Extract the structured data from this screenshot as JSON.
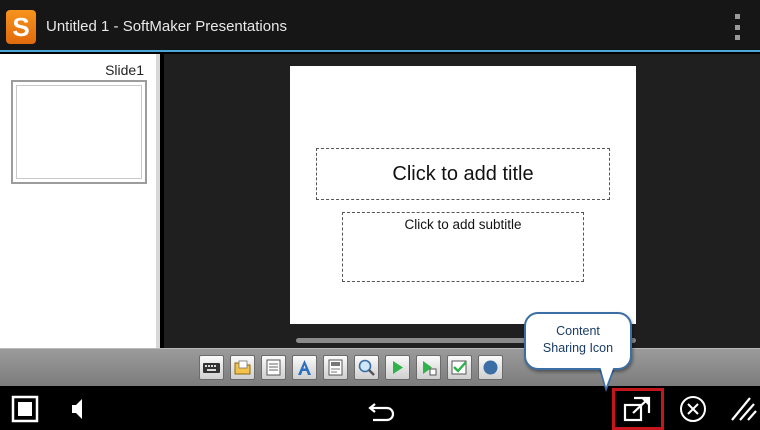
{
  "titlebar": {
    "logo_letter": "S",
    "title": "Untitled 1 - SoftMaker Presentations"
  },
  "slides_panel": {
    "slides": [
      {
        "label": "Slide1"
      }
    ]
  },
  "slide": {
    "title_placeholder": "Click to add title",
    "subtitle_placeholder": "Click to add subtitle"
  },
  "toolbar": {
    "buttons": [
      {
        "icon": "keyboard-icon"
      },
      {
        "icon": "open-folder-icon"
      },
      {
        "icon": "slide-layout-icon"
      },
      {
        "icon": "text-format-icon"
      },
      {
        "icon": "object-properties-icon"
      },
      {
        "icon": "zoom-icon"
      },
      {
        "icon": "play-icon"
      },
      {
        "icon": "play-from-current-icon"
      },
      {
        "icon": "checkbox-icon"
      },
      {
        "icon": "more-icon"
      }
    ]
  },
  "navbar": {
    "buttons": [
      {
        "icon": "recents-icon"
      },
      {
        "icon": "volume-icon"
      },
      {
        "icon": "back-icon"
      },
      {
        "icon": "content-sharing-icon"
      },
      {
        "icon": "close-icon"
      },
      {
        "icon": "resize-handle-icon"
      }
    ]
  },
  "annotation": {
    "callout_line1": "Content",
    "callout_line2": "Sharing Icon",
    "highlight_color": "#c4161c"
  },
  "colors": {
    "title_accent": "#4aa8d8",
    "logo": "#f7931e",
    "callout_border": "#3a6ea5"
  }
}
